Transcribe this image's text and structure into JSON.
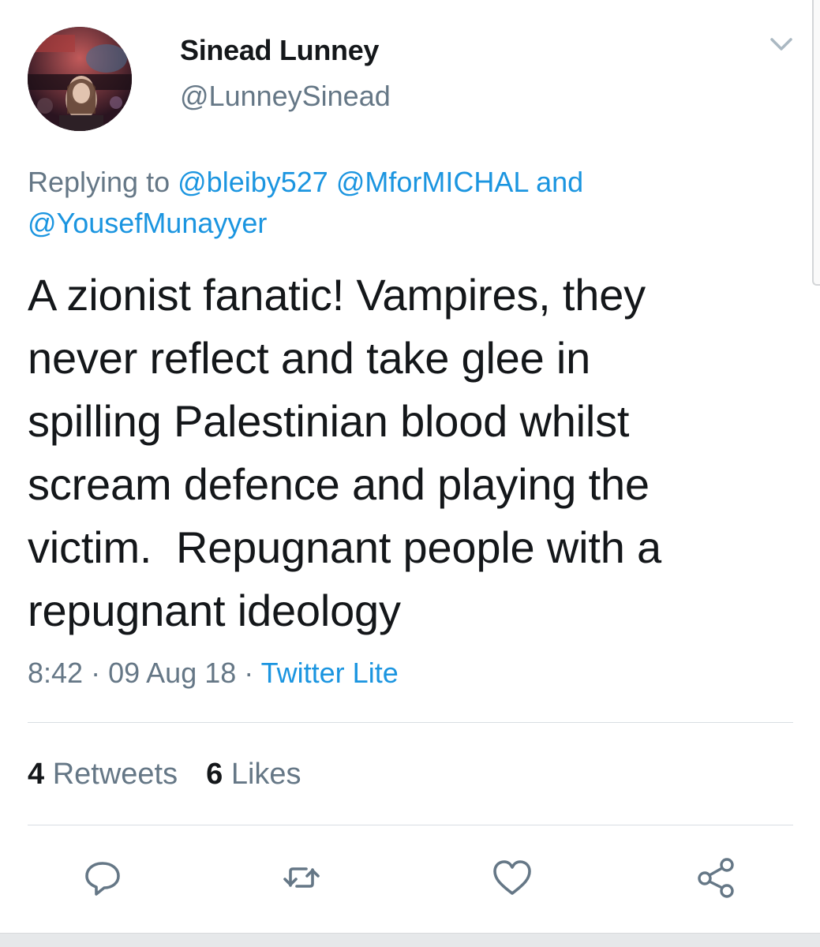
{
  "tweet": {
    "author_name": "Sinead Lunney",
    "author_handle": "@LunneySinead",
    "replying_prefix": "Replying to",
    "reply_mentions": [
      "@bleiby527",
      "@MforMICHAL",
      "and",
      "@YousefMunayyer"
    ],
    "text": "A zionist fanatic! Vampires, they\nnever reflect and take glee in\nspilling Palestinian blood whilst\nscream defence and playing the\nvictim.  Repugnant people with a\nrepugnant ideology",
    "time": "8:42",
    "separator": "·",
    "date": "09 Aug 18",
    "source": "Twitter Lite"
  },
  "stats": {
    "retweets_count": "4",
    "retweets_label": "Retweets",
    "likes_count": "6",
    "likes_label": "Likes"
  },
  "actions": [
    {
      "icon": "reply-icon"
    },
    {
      "icon": "retweet-icon"
    },
    {
      "icon": "like-icon"
    },
    {
      "icon": "share-icon"
    }
  ],
  "colors": {
    "link": "#1b95e0",
    "secondary_text": "#657786",
    "primary_text": "#14171a",
    "divider": "#d8dee3"
  }
}
